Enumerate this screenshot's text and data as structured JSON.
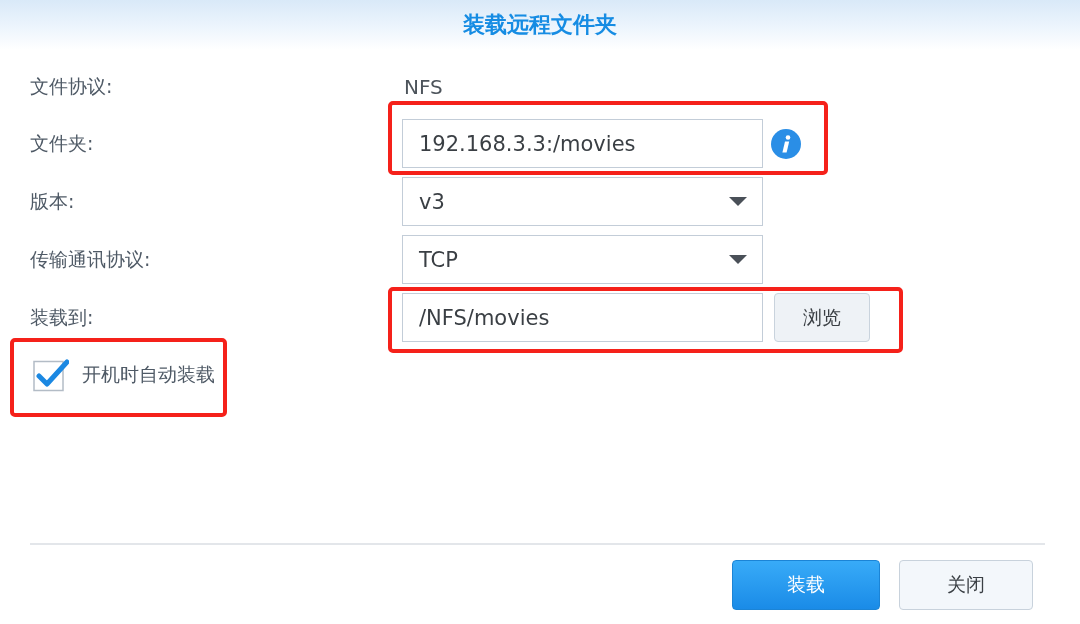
{
  "dialog": {
    "title": "装载远程文件夹"
  },
  "rows": [
    {
      "kind": "text",
      "label": "文件协议:",
      "value": "NFS",
      "highlighted": false
    },
    {
      "kind": "input",
      "label": "文件夹:",
      "value": "192.168.3.3:/movies",
      "info": true,
      "highlighted": true
    },
    {
      "kind": "select",
      "label": "版本:",
      "value": "v3",
      "highlighted": false
    },
    {
      "kind": "select",
      "label": "传输通讯协议:",
      "value": "TCP",
      "highlighted": false
    },
    {
      "kind": "browse",
      "label": "装载到:",
      "value": "/NFS/movies",
      "button": "浏览",
      "highlighted": true
    }
  ],
  "auto_mount": {
    "label": "开机时自动装载",
    "checked": true,
    "highlighted": true
  },
  "buttons": [
    {
      "label": "装载",
      "kind": "primary"
    },
    {
      "label": "关闭",
      "kind": "secondary"
    }
  ]
}
